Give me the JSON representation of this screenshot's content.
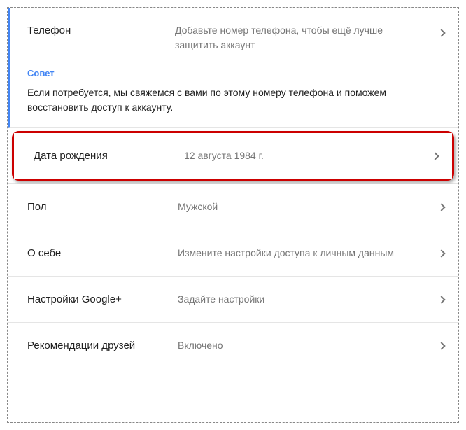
{
  "rows": {
    "phone": {
      "label": "Телефон",
      "value": "Добавьте номер телефона, чтобы ещё лучше защитить аккаунт",
      "hint_title": "Совет",
      "hint_text": "Если потребуется, мы свяжемся с вами по этому номеру телефона и поможем восстановить доступ к аккаунту."
    },
    "birthday": {
      "label": "Дата рождения",
      "value": "12 августа 1984 г."
    },
    "gender": {
      "label": "Пол",
      "value": "Мужской"
    },
    "about": {
      "label": "О себе",
      "value": "Измените настройки доступа к личным данным"
    },
    "gplus": {
      "label": "Настройки Google+",
      "value": "Задайте настройки"
    },
    "friends": {
      "label": "Рекомендации друзей",
      "value": "Включено"
    }
  }
}
